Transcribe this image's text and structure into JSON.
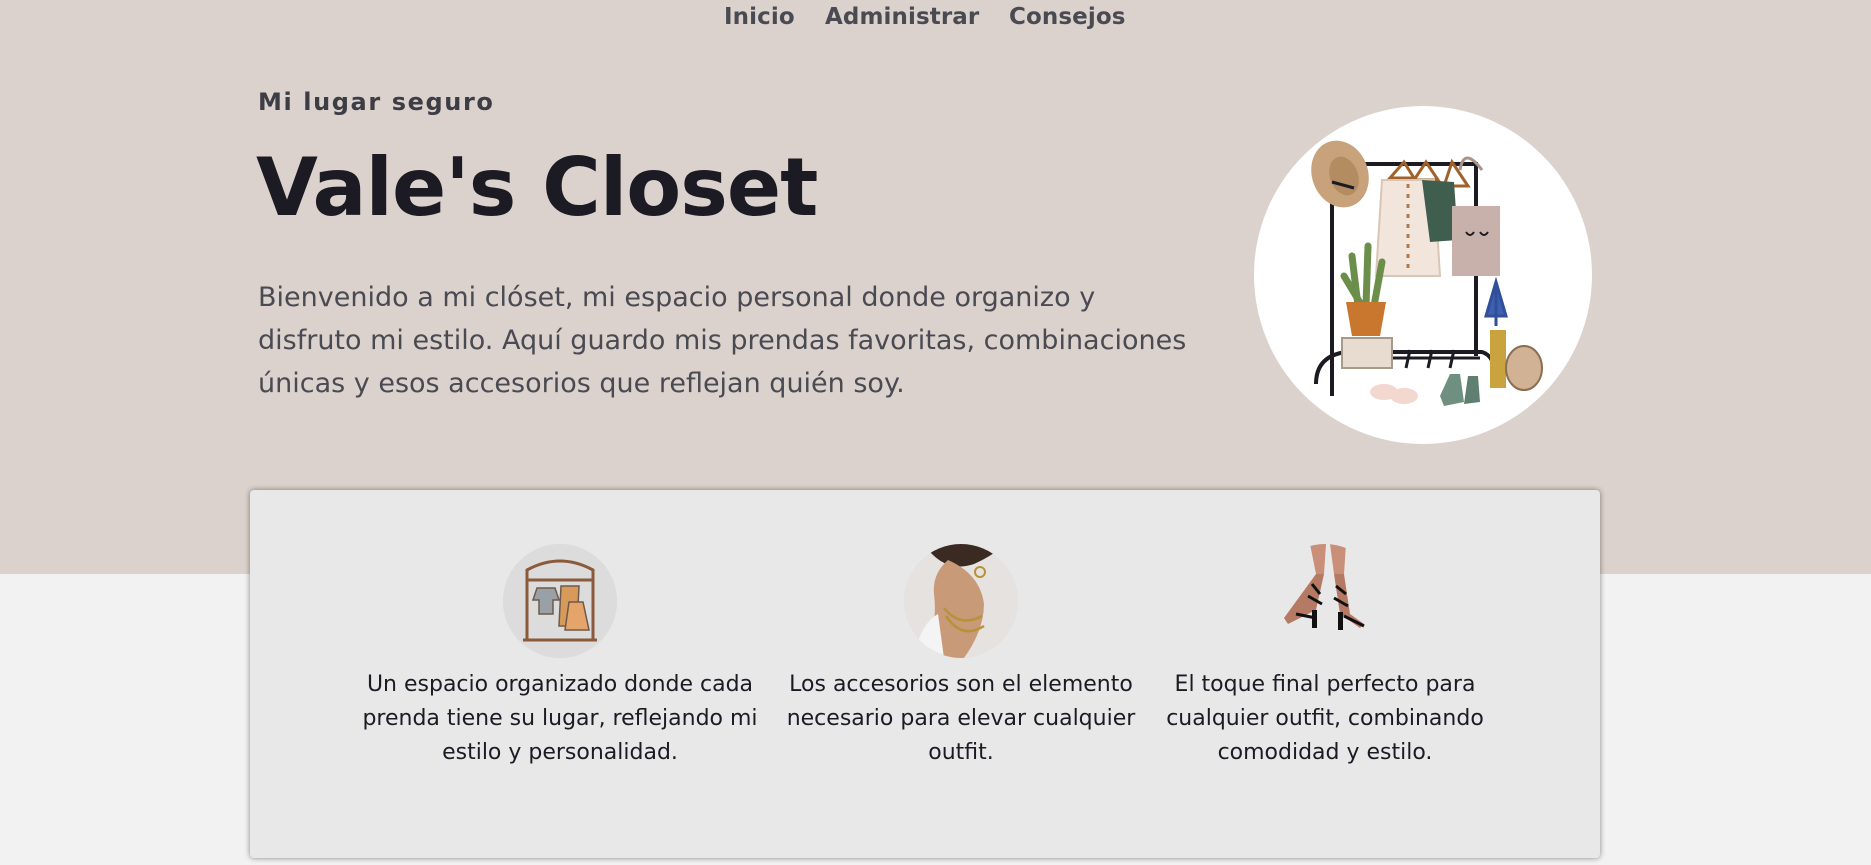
{
  "nav": {
    "items": [
      {
        "label": "Inicio"
      },
      {
        "label": "Administrar"
      },
      {
        "label": "Consejos"
      }
    ]
  },
  "hero": {
    "eyebrow": "Mi lugar seguro",
    "title": "Vale's Closet",
    "description": "Bienvenido a mi clóset, mi espacio personal donde organizo y disfruto mi estilo. Aquí guardo mis prendas favoritas, combinaciones únicas y esos accesorios que reflejan quién soy.",
    "image_icon": "clothing-rack-illustration"
  },
  "features": [
    {
      "icon": "wardrobe-icon",
      "text": "Un espacio organizado donde cada prenda tiene su lugar, reflejando mi estilo y personalidad."
    },
    {
      "icon": "accessories-icon",
      "text": "Los accesorios son el elemento necesario para elevar cualquier outfit."
    },
    {
      "icon": "heels-icon",
      "text": "El toque final perfecto para cualquier outfit, combinando comodidad y estilo."
    }
  ],
  "colors": {
    "hero_background": "#dcd2cd",
    "page_background": "#f2f2f2",
    "card_background": "#e9e8e8",
    "title_text": "#1c1b24",
    "nav_text": "#4a4a52"
  }
}
